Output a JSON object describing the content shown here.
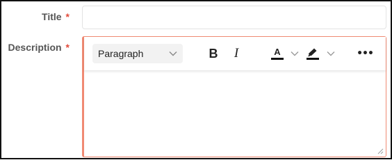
{
  "form": {
    "title_field": {
      "label": "Title",
      "required_marker": "*",
      "value": "",
      "placeholder": ""
    },
    "description_field": {
      "label": "Description",
      "required_marker": "*",
      "value": ""
    }
  },
  "toolbar": {
    "block_format": "Paragraph",
    "buttons": [
      {
        "name": "bold",
        "glyph": "B",
        "icon": "bold-icon"
      },
      {
        "name": "italic",
        "glyph": "I",
        "icon": "italic-icon"
      },
      {
        "name": "text-color",
        "glyph": "A",
        "icon": "text-color-icon"
      },
      {
        "name": "highlight",
        "icon": "highlight-marker-icon"
      },
      {
        "name": "more",
        "glyph": "•••",
        "icon": "more-icon"
      }
    ]
  },
  "colors": {
    "required": "#e24b3b",
    "editor_border": "#f08a73",
    "label": "#555555"
  }
}
